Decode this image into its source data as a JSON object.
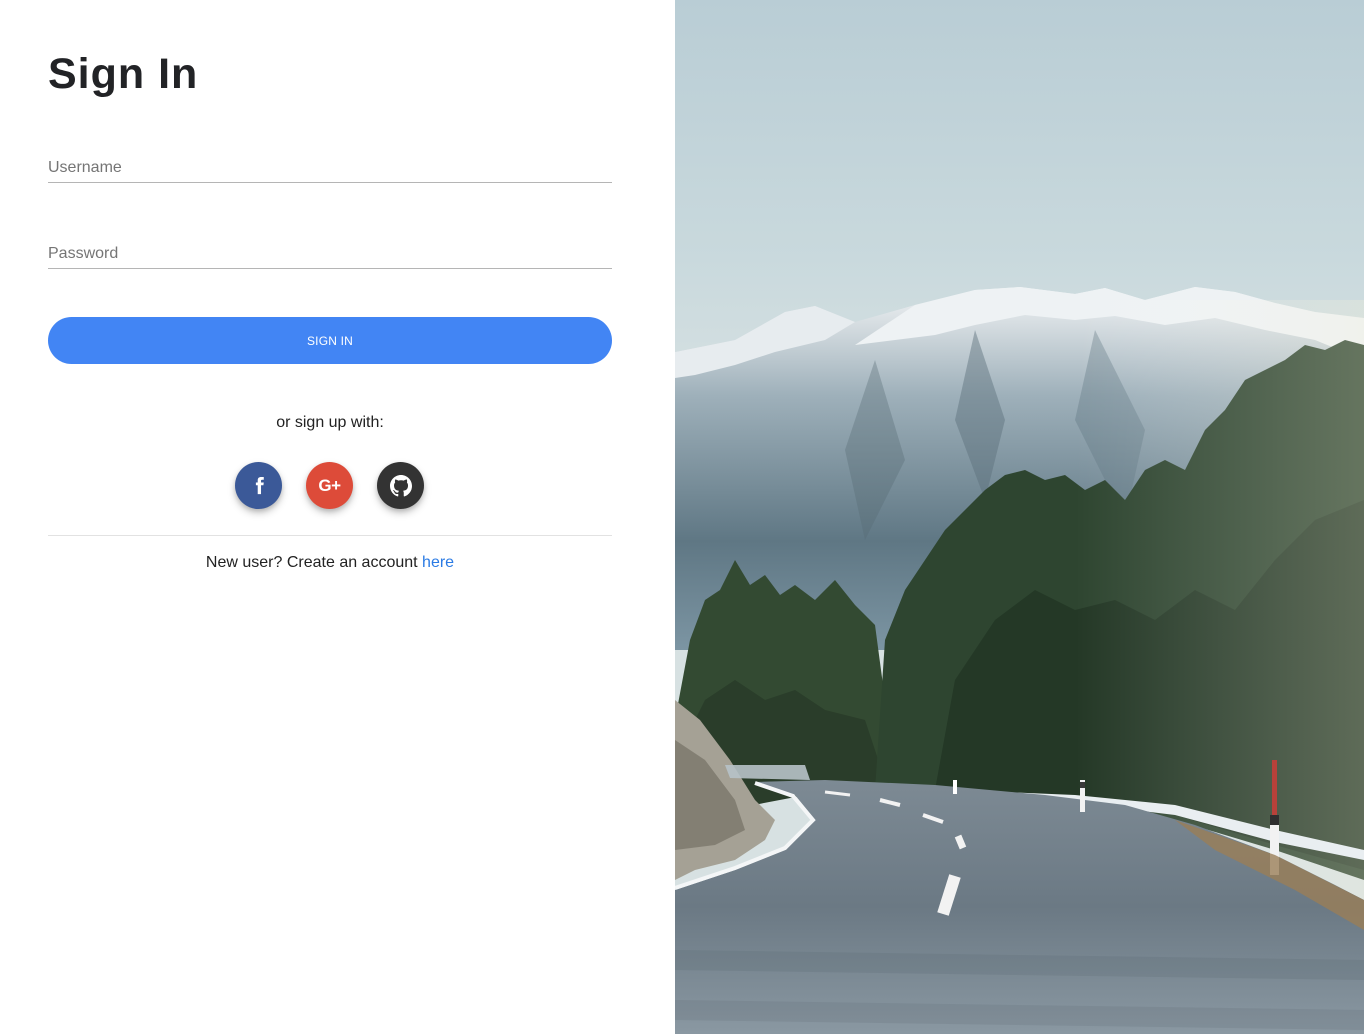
{
  "signin": {
    "title": "Sign In",
    "username_placeholder": "Username",
    "password_placeholder": "Password",
    "submit_label": "SIGN IN",
    "or_text": "or sign up with:",
    "socials": [
      {
        "name": "facebook",
        "icon": "facebook-icon",
        "color": "#3b5998"
      },
      {
        "name": "google-plus",
        "icon": "google-plus-icon",
        "label": "G+",
        "color": "#dd4b39"
      },
      {
        "name": "github",
        "icon": "github-icon",
        "color": "#333333"
      }
    ],
    "new_user_text": "New user? Create an account ",
    "new_user_link": "here"
  },
  "colors": {
    "primary": "#4285f4",
    "link": "#2b7be4",
    "title": "#222326"
  },
  "hero_image": {
    "subject": "snowy-mountain-road-landscape"
  }
}
